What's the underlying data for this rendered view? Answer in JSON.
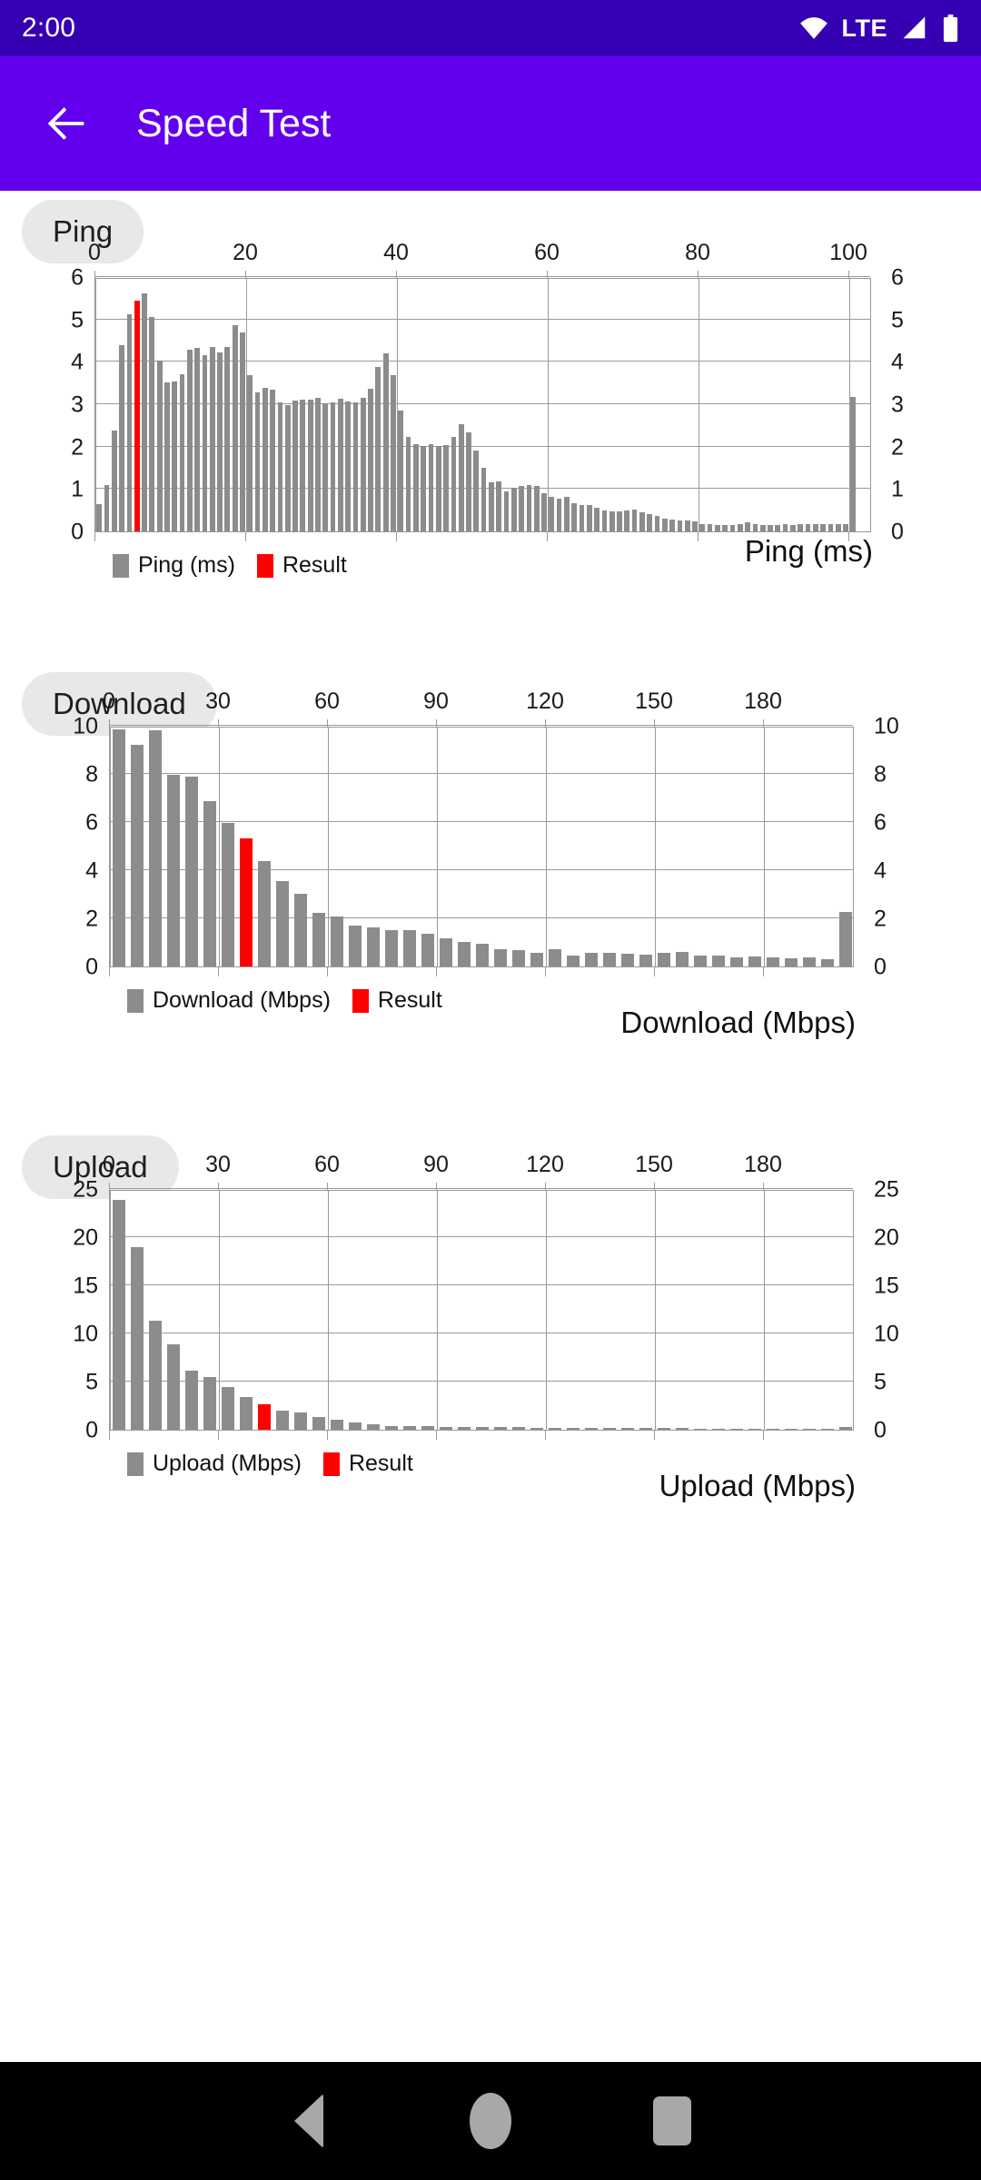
{
  "status_bar": {
    "clock": "2:00",
    "network_label": "LTE",
    "icons": [
      "wifi-icon",
      "signal-icon",
      "battery-icon"
    ]
  },
  "app_bar": {
    "back_icon": "arrow-back-icon",
    "title": "Speed Test"
  },
  "sections": [
    {
      "chip_label": "Ping"
    },
    {
      "chip_label": "Download"
    },
    {
      "chip_label": "Upload"
    }
  ],
  "nav_bar": {
    "back": "nav-back-icon",
    "home": "nav-home-icon",
    "recent": "nav-recents-icon"
  },
  "colors": {
    "status_bar": "#3600b3",
    "app_bar": "#6200ee",
    "bar": "#8c8c8c",
    "result_bar": "#fe0000",
    "chip_bg": "#e8e8e8",
    "grid": "#9a9a9a"
  },
  "chart_data": [
    {
      "type": "bar",
      "id": "ping",
      "title": "Ping",
      "xlabel": "",
      "ylabel": "",
      "axis_title": "Ping (ms)",
      "legend": [
        {
          "label": "Ping (ms)",
          "color": "#8c8c8c"
        },
        {
          "label": "Result",
          "color": "#fe0000"
        }
      ],
      "legend_position": "bottom-left",
      "grid": true,
      "xlim": [
        0,
        103
      ],
      "ylim": [
        0,
        6
      ],
      "xticks": [
        0,
        20,
        40,
        60,
        80,
        100
      ],
      "yticks": [
        0,
        1,
        2,
        3,
        4,
        5,
        6
      ],
      "y_axis_both_sides": true,
      "result_index": 5,
      "x": [
        0,
        1,
        2,
        3,
        4,
        5,
        6,
        7,
        8,
        9,
        10,
        11,
        12,
        13,
        14,
        15,
        16,
        17,
        18,
        19,
        20,
        21,
        22,
        23,
        24,
        25,
        26,
        27,
        28,
        29,
        30,
        31,
        32,
        33,
        34,
        35,
        36,
        37,
        38,
        39,
        40,
        41,
        42,
        43,
        44,
        45,
        46,
        47,
        48,
        49,
        50,
        51,
        52,
        53,
        54,
        55,
        56,
        57,
        58,
        59,
        60,
        61,
        62,
        63,
        64,
        65,
        66,
        67,
        68,
        69,
        70,
        71,
        72,
        73,
        74,
        75,
        76,
        77,
        78,
        79,
        80,
        81,
        82,
        83,
        84,
        85,
        86,
        87,
        88,
        89,
        90,
        91,
        92,
        93,
        94,
        95,
        96,
        97,
        98,
        99,
        100
      ],
      "values": [
        0.65,
        1.1,
        2.37,
        4.4,
        5.13,
        5.45,
        5.62,
        5.05,
        4.03,
        3.52,
        3.53,
        3.7,
        4.28,
        4.32,
        4.15,
        4.34,
        4.23,
        4.35,
        4.87,
        4.69,
        3.68,
        3.27,
        3.39,
        3.34,
        3.05,
        2.97,
        3.08,
        3.11,
        3.1,
        3.14,
        3.03,
        3.05,
        3.12,
        3.06,
        3.04,
        3.14,
        3.37,
        3.88,
        4.19,
        3.68,
        2.85,
        2.23,
        2.06,
        2.02,
        2.05,
        2.02,
        2.04,
        2.22,
        2.53,
        2.34,
        1.9,
        1.49,
        1.16,
        1.17,
        0.94,
        1.02,
        1.08,
        1.1,
        1.07,
        0.9,
        0.82,
        0.77,
        0.81,
        0.66,
        0.62,
        0.63,
        0.56,
        0.5,
        0.47,
        0.48,
        0.5,
        0.51,
        0.44,
        0.4,
        0.36,
        0.3,
        0.28,
        0.26,
        0.25,
        0.23,
        0.17,
        0.17,
        0.16,
        0.15,
        0.14,
        0.17,
        0.21,
        0.17,
        0.16,
        0.16,
        0.16,
        0.18,
        0.16,
        0.17,
        0.17,
        0.17,
        0.17,
        0.17,
        0.17,
        0.18,
        3.17
      ]
    },
    {
      "type": "bar",
      "id": "download",
      "title": "Download",
      "xlabel": "",
      "ylabel": "",
      "axis_title": "Download (Mbps)",
      "legend": [
        {
          "label": "Download (Mbps)",
          "color": "#8c8c8c"
        },
        {
          "label": "Result",
          "color": "#fe0000"
        }
      ],
      "legend_position": "bottom-left",
      "grid": true,
      "xlim": [
        0,
        205
      ],
      "ylim": [
        0,
        10
      ],
      "xticks": [
        0,
        30,
        60,
        90,
        120,
        150,
        180
      ],
      "yticks": [
        0,
        2,
        4,
        6,
        8,
        10
      ],
      "y_axis_both_sides": true,
      "result_index": 7,
      "x": [
        0,
        5,
        10,
        15,
        20,
        25,
        30,
        35,
        40,
        45,
        50,
        55,
        60,
        65,
        70,
        75,
        80,
        85,
        90,
        95,
        100,
        105,
        110,
        115,
        120,
        125,
        130,
        135,
        140,
        145,
        150,
        155,
        160,
        165,
        170,
        175,
        180,
        185,
        190,
        195,
        200
      ],
      "values": [
        9.85,
        9.2,
        9.83,
        7.97,
        7.88,
        6.87,
        5.95,
        5.33,
        4.37,
        3.55,
        3.01,
        2.22,
        2.08,
        1.69,
        1.62,
        1.5,
        1.51,
        1.36,
        1.17,
        1.02,
        0.94,
        0.71,
        0.68,
        0.58,
        0.71,
        0.44,
        0.58,
        0.55,
        0.53,
        0.51,
        0.58,
        0.61,
        0.46,
        0.45,
        0.36,
        0.42,
        0.38,
        0.34,
        0.36,
        0.3,
        2.27
      ]
    },
    {
      "type": "bar",
      "id": "upload",
      "title": "Upload",
      "xlabel": "",
      "ylabel": "",
      "axis_title": "Upload (Mbps)",
      "legend": [
        {
          "label": "Upload (Mbps)",
          "color": "#8c8c8c"
        },
        {
          "label": "Result",
          "color": "#fe0000"
        }
      ],
      "legend_position": "bottom-left",
      "grid": true,
      "xlim": [
        0,
        205
      ],
      "ylim": [
        0,
        25
      ],
      "xticks": [
        0,
        30,
        60,
        90,
        120,
        150,
        180
      ],
      "yticks": [
        0,
        5,
        10,
        15,
        20,
        25
      ],
      "y_axis_both_sides": true,
      "result_index": 8,
      "x": [
        0,
        5,
        10,
        15,
        20,
        25,
        30,
        35,
        40,
        45,
        50,
        55,
        60,
        65,
        70,
        75,
        80,
        85,
        90,
        95,
        100,
        105,
        110,
        115,
        120,
        125,
        130,
        135,
        140,
        145,
        150,
        155,
        160,
        165,
        170,
        175,
        180,
        185,
        190,
        195,
        200
      ],
      "values": [
        23.9,
        19.0,
        11.3,
        8.9,
        6.1,
        5.5,
        4.4,
        3.4,
        2.6,
        2.0,
        1.8,
        1.3,
        1.0,
        0.8,
        0.6,
        0.4,
        0.4,
        0.35,
        0.3,
        0.3,
        0.3,
        0.25,
        0.25,
        0.2,
        0.2,
        0.2,
        0.2,
        0.2,
        0.2,
        0.15,
        0.15,
        0.15,
        0.12,
        0.12,
        0.1,
        0.1,
        0.1,
        0.1,
        0.1,
        0.1,
        0.25
      ]
    }
  ]
}
